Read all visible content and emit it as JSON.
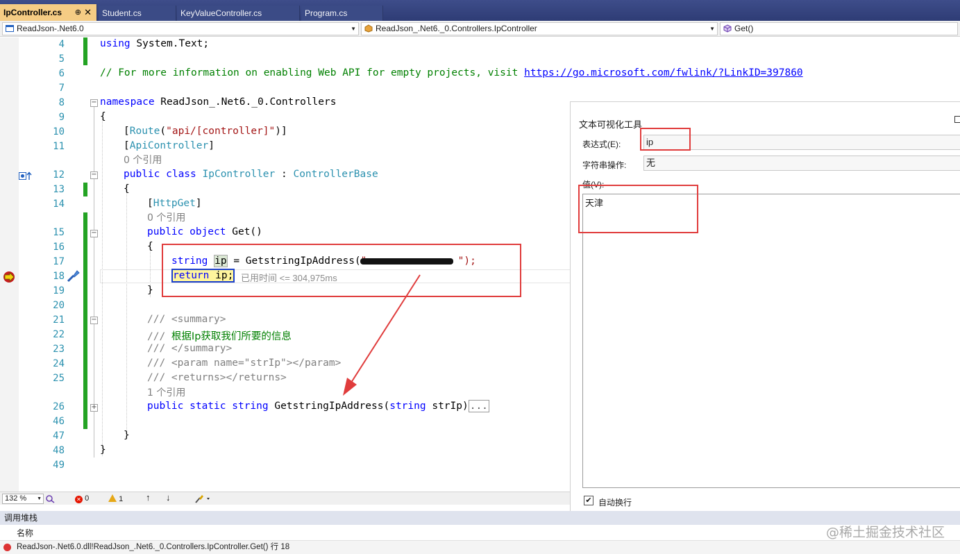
{
  "tabs": [
    {
      "label": "IpController.cs",
      "pin": "⊕",
      "close": "✕"
    },
    {
      "label": "Student.cs"
    },
    {
      "label": "KeyValueController.cs"
    },
    {
      "label": "Program.cs"
    }
  ],
  "nav": {
    "project": "ReadJson-.Net6.0",
    "type": "ReadJson_.Net6._0.Controllers.IpController",
    "member": "Get()"
  },
  "line_numbers": [
    "4",
    "5",
    "6",
    "7",
    "8",
    "9",
    "10",
    "11",
    "12",
    "13",
    "14",
    "15",
    "16",
    "17",
    "18",
    "19",
    "20",
    "21",
    "22",
    "23",
    "24",
    "25",
    "26",
    "46",
    "47",
    "48",
    "49"
  ],
  "code": {
    "l4_using": "using",
    "l4_rest": " System.Text;",
    "l6_comment": "// For more information on enabling Web API for empty projects, visit ",
    "l6_url": "https://go.microsoft.com/fwlink/?LinkID=397860",
    "l8_kw": "namespace",
    "l8_rest": " ReadJson_.Net6._0.Controllers",
    "brace_open": "{",
    "brace_close": "}",
    "l10_a": "[",
    "l10_route": "Route",
    "l10_b": "(",
    "l10_str": "\"api/[controller]\"",
    "l10_c": ")]",
    "l11_a": "[",
    "l11_attr": "ApiController",
    "l11_b": "]",
    "ref0": "0 个引用",
    "ref0b": "0 个引用",
    "ref1": "1 个引用",
    "l12_public": "public",
    "l12_class": " class ",
    "l12_name": "IpController",
    "l12_colon": " : ",
    "l12_base": "ControllerBase",
    "l14_a": "[",
    "l14_attr": "HttpGet",
    "l14_b": "]",
    "l15_public": "public",
    "l15_object": " object",
    "l15_rest": " Get()",
    "l17_string": "string",
    "l17_ip": "ip",
    "l17_rest": " = GetstringIpAddress(",
    "l17_str_end": "\");",
    "l18_return": "return",
    "l18_rest": " ip;",
    "perf_tip": "已用时间 <= 304,975ms",
    "l21_a": "/// ",
    "l21_b": "<summary>",
    "l22_a": "/// ",
    "l22_b": "根据Ip获取我们所要的信息",
    "l23_a": "/// ",
    "l23_b": "</summary>",
    "l24_a": "/// ",
    "l24_b": "<param name=\"strIp\"></param>",
    "l25_a": "/// ",
    "l25_b": "<returns></returns>",
    "l26_public": "public",
    "l26_static": " static",
    "l26_string": " string",
    "l26_name": " GetstringIpAddress(",
    "l26_string2": "string",
    "l26_param": " strIp)",
    "l26_ellipsis": "..."
  },
  "visualizer": {
    "title": "文本可视化工具",
    "expression_label": "表达式(E):",
    "expression_value": "ip",
    "string_op_label": "字符串操作:",
    "string_op_value": "无",
    "value_label": "值(V):",
    "value_text": "天津",
    "wrap_label": "自动换行",
    "wrap_checked": "✔"
  },
  "status": {
    "zoom": "132 %",
    "errors": "0",
    "warnings": "1",
    "up": "↑",
    "down": "↓"
  },
  "callstack": {
    "title": "调用堆栈",
    "column_name": "名称",
    "row": "ReadJson-.Net6.0.dll!ReadJson_.Net6._0.Controllers.IpController.Get() 行 18"
  },
  "watermark": "@稀土掘金技术社区",
  "colors": {
    "keyword": "#0000ff",
    "type": "#2b91af",
    "string": "#a31515",
    "comment": "#008000",
    "annotation_red": "#e03c3c",
    "change_bar": "#23a323"
  }
}
